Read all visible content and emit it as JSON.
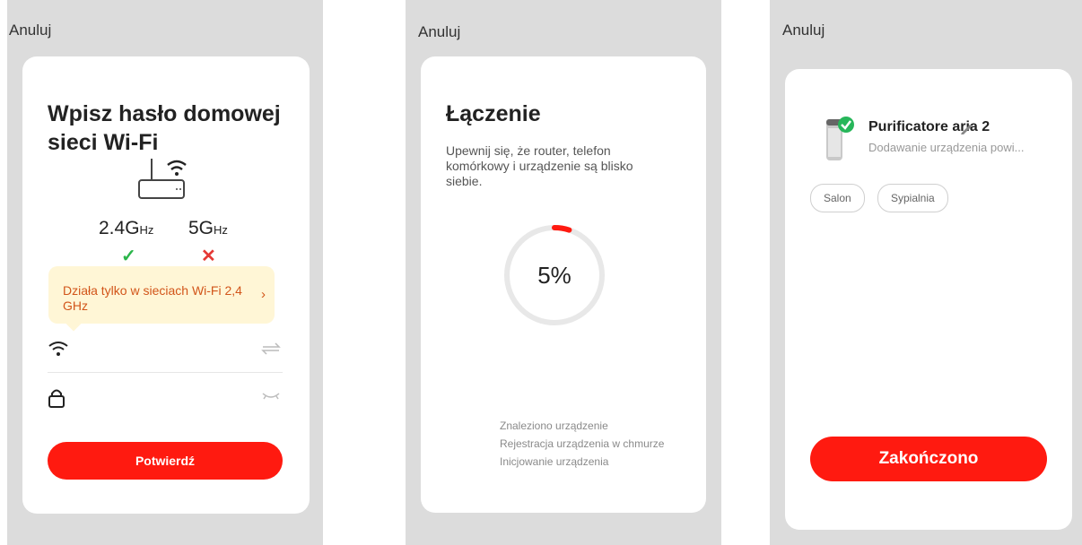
{
  "screen_connect_wifi": {
    "cancel_label": "Anuluj",
    "title": "Wpisz hasło domowej sieci Wi-Fi",
    "freq_24_main": "2.4G",
    "freq_24_unit": "Hz",
    "freq_5_main": "5G",
    "freq_5_unit": "Hz",
    "tip_text": "Działa tylko w sieciach Wi-Fi 2,4 GHz",
    "ssid_value": "",
    "password_value": "",
    "confirm_label": "Potwierdź"
  },
  "screen_connecting": {
    "cancel_label": "Anuluj",
    "title": "Łączenie",
    "description": "Upewnij się, że router, telefon komórkowy i urządzenie są blisko siebie.",
    "progress_percent": 5,
    "progress_label": "5%",
    "steps": [
      "Znaleziono urządzenie",
      "Rejestracja urządzenia w chmurze",
      "Inicjowanie urządzenia"
    ]
  },
  "screen_done": {
    "cancel_label": "Anuluj",
    "device_name": "Purificatore aria 2",
    "device_status": "Dodawanie urządzenia powi...",
    "rooms": [
      "Salon",
      "Sypialnia"
    ],
    "finish_label": "Zakończono"
  },
  "colors": {
    "accent_red": "#ff1a10",
    "success_green": "#2bb54a",
    "error_red": "#e53935",
    "tip_bg": "#fff6d6",
    "tip_text": "#d2551a",
    "panel_bg": "#dcdcdc"
  },
  "icons": [
    "router-icon",
    "check-icon",
    "cross-icon",
    "chevron-right-icon",
    "wifi-icon",
    "swap-icon",
    "lock-icon",
    "eye-closed-icon",
    "purifier-icon",
    "check-badge-icon",
    "pencil-icon"
  ]
}
